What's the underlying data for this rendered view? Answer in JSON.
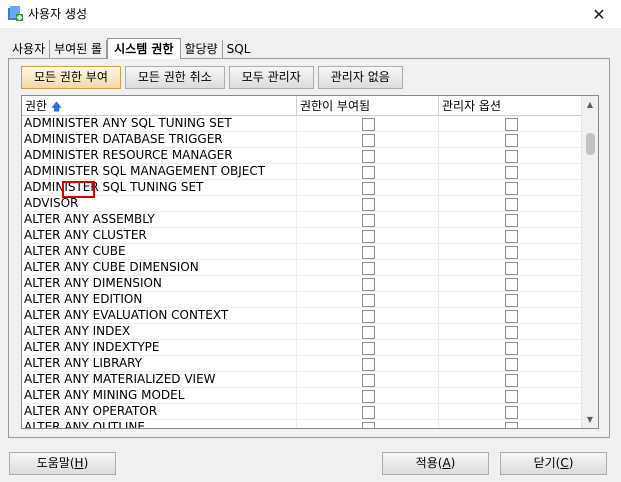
{
  "window": {
    "title": "사용자 생성",
    "close_glyph": "✕"
  },
  "tabs": [
    {
      "label": "사용자"
    },
    {
      "label": "부여된 롤"
    },
    {
      "label": "시스템 권한"
    },
    {
      "label": "할당량"
    },
    {
      "label": "SQL"
    }
  ],
  "toolbar": {
    "grant_all": "모든 권한 부여",
    "revoke_all": "모든 권한 취소",
    "all_admin": "모두 관리자",
    "no_admin": "관리자 없음"
  },
  "grid": {
    "headers": {
      "privilege": "권한",
      "granted": "권한이 부여됨",
      "admin": "관리자 옵션"
    },
    "sort_icon": "sort-ascending-icon",
    "rows": [
      {
        "name": "ADMINISTER ANY SQL TUNING SET",
        "granted": false,
        "admin": false
      },
      {
        "name": "ADMINISTER DATABASE TRIGGER",
        "granted": false,
        "admin": false
      },
      {
        "name": "ADMINISTER RESOURCE MANAGER",
        "granted": false,
        "admin": false
      },
      {
        "name": "ADMINISTER SQL MANAGEMENT OBJECT",
        "granted": false,
        "admin": false
      },
      {
        "name": "ADMINISTER SQL TUNING SET",
        "granted": false,
        "admin": false
      },
      {
        "name": "ADVISOR",
        "granted": false,
        "admin": false
      },
      {
        "name": "ALTER ANY ASSEMBLY",
        "granted": false,
        "admin": false
      },
      {
        "name": "ALTER ANY CLUSTER",
        "granted": false,
        "admin": false
      },
      {
        "name": "ALTER ANY CUBE",
        "granted": false,
        "admin": false
      },
      {
        "name": "ALTER ANY CUBE DIMENSION",
        "granted": false,
        "admin": false
      },
      {
        "name": "ALTER ANY DIMENSION",
        "granted": false,
        "admin": false
      },
      {
        "name": "ALTER ANY EDITION",
        "granted": false,
        "admin": false
      },
      {
        "name": "ALTER ANY EVALUATION CONTEXT",
        "granted": false,
        "admin": false
      },
      {
        "name": "ALTER ANY INDEX",
        "granted": false,
        "admin": false
      },
      {
        "name": "ALTER ANY INDEXTYPE",
        "granted": false,
        "admin": false
      },
      {
        "name": "ALTER ANY LIBRARY",
        "granted": false,
        "admin": false
      },
      {
        "name": "ALTER ANY MATERIALIZED VIEW",
        "granted": false,
        "admin": false
      },
      {
        "name": "ALTER ANY MINING MODEL",
        "granted": false,
        "admin": false
      },
      {
        "name": "ALTER ANY OPERATOR",
        "granted": false,
        "admin": false
      },
      {
        "name": "ALTER ANY OUTLINE",
        "granted": false,
        "admin": false
      }
    ]
  },
  "footer": {
    "help_label": "도움말",
    "help_key": "H",
    "apply_label": "적용",
    "apply_key": "A",
    "close_label": "닫기",
    "close_key": "C"
  },
  "colors": {
    "highlight": "#e00000",
    "primary_button": "#f1d9a6"
  }
}
